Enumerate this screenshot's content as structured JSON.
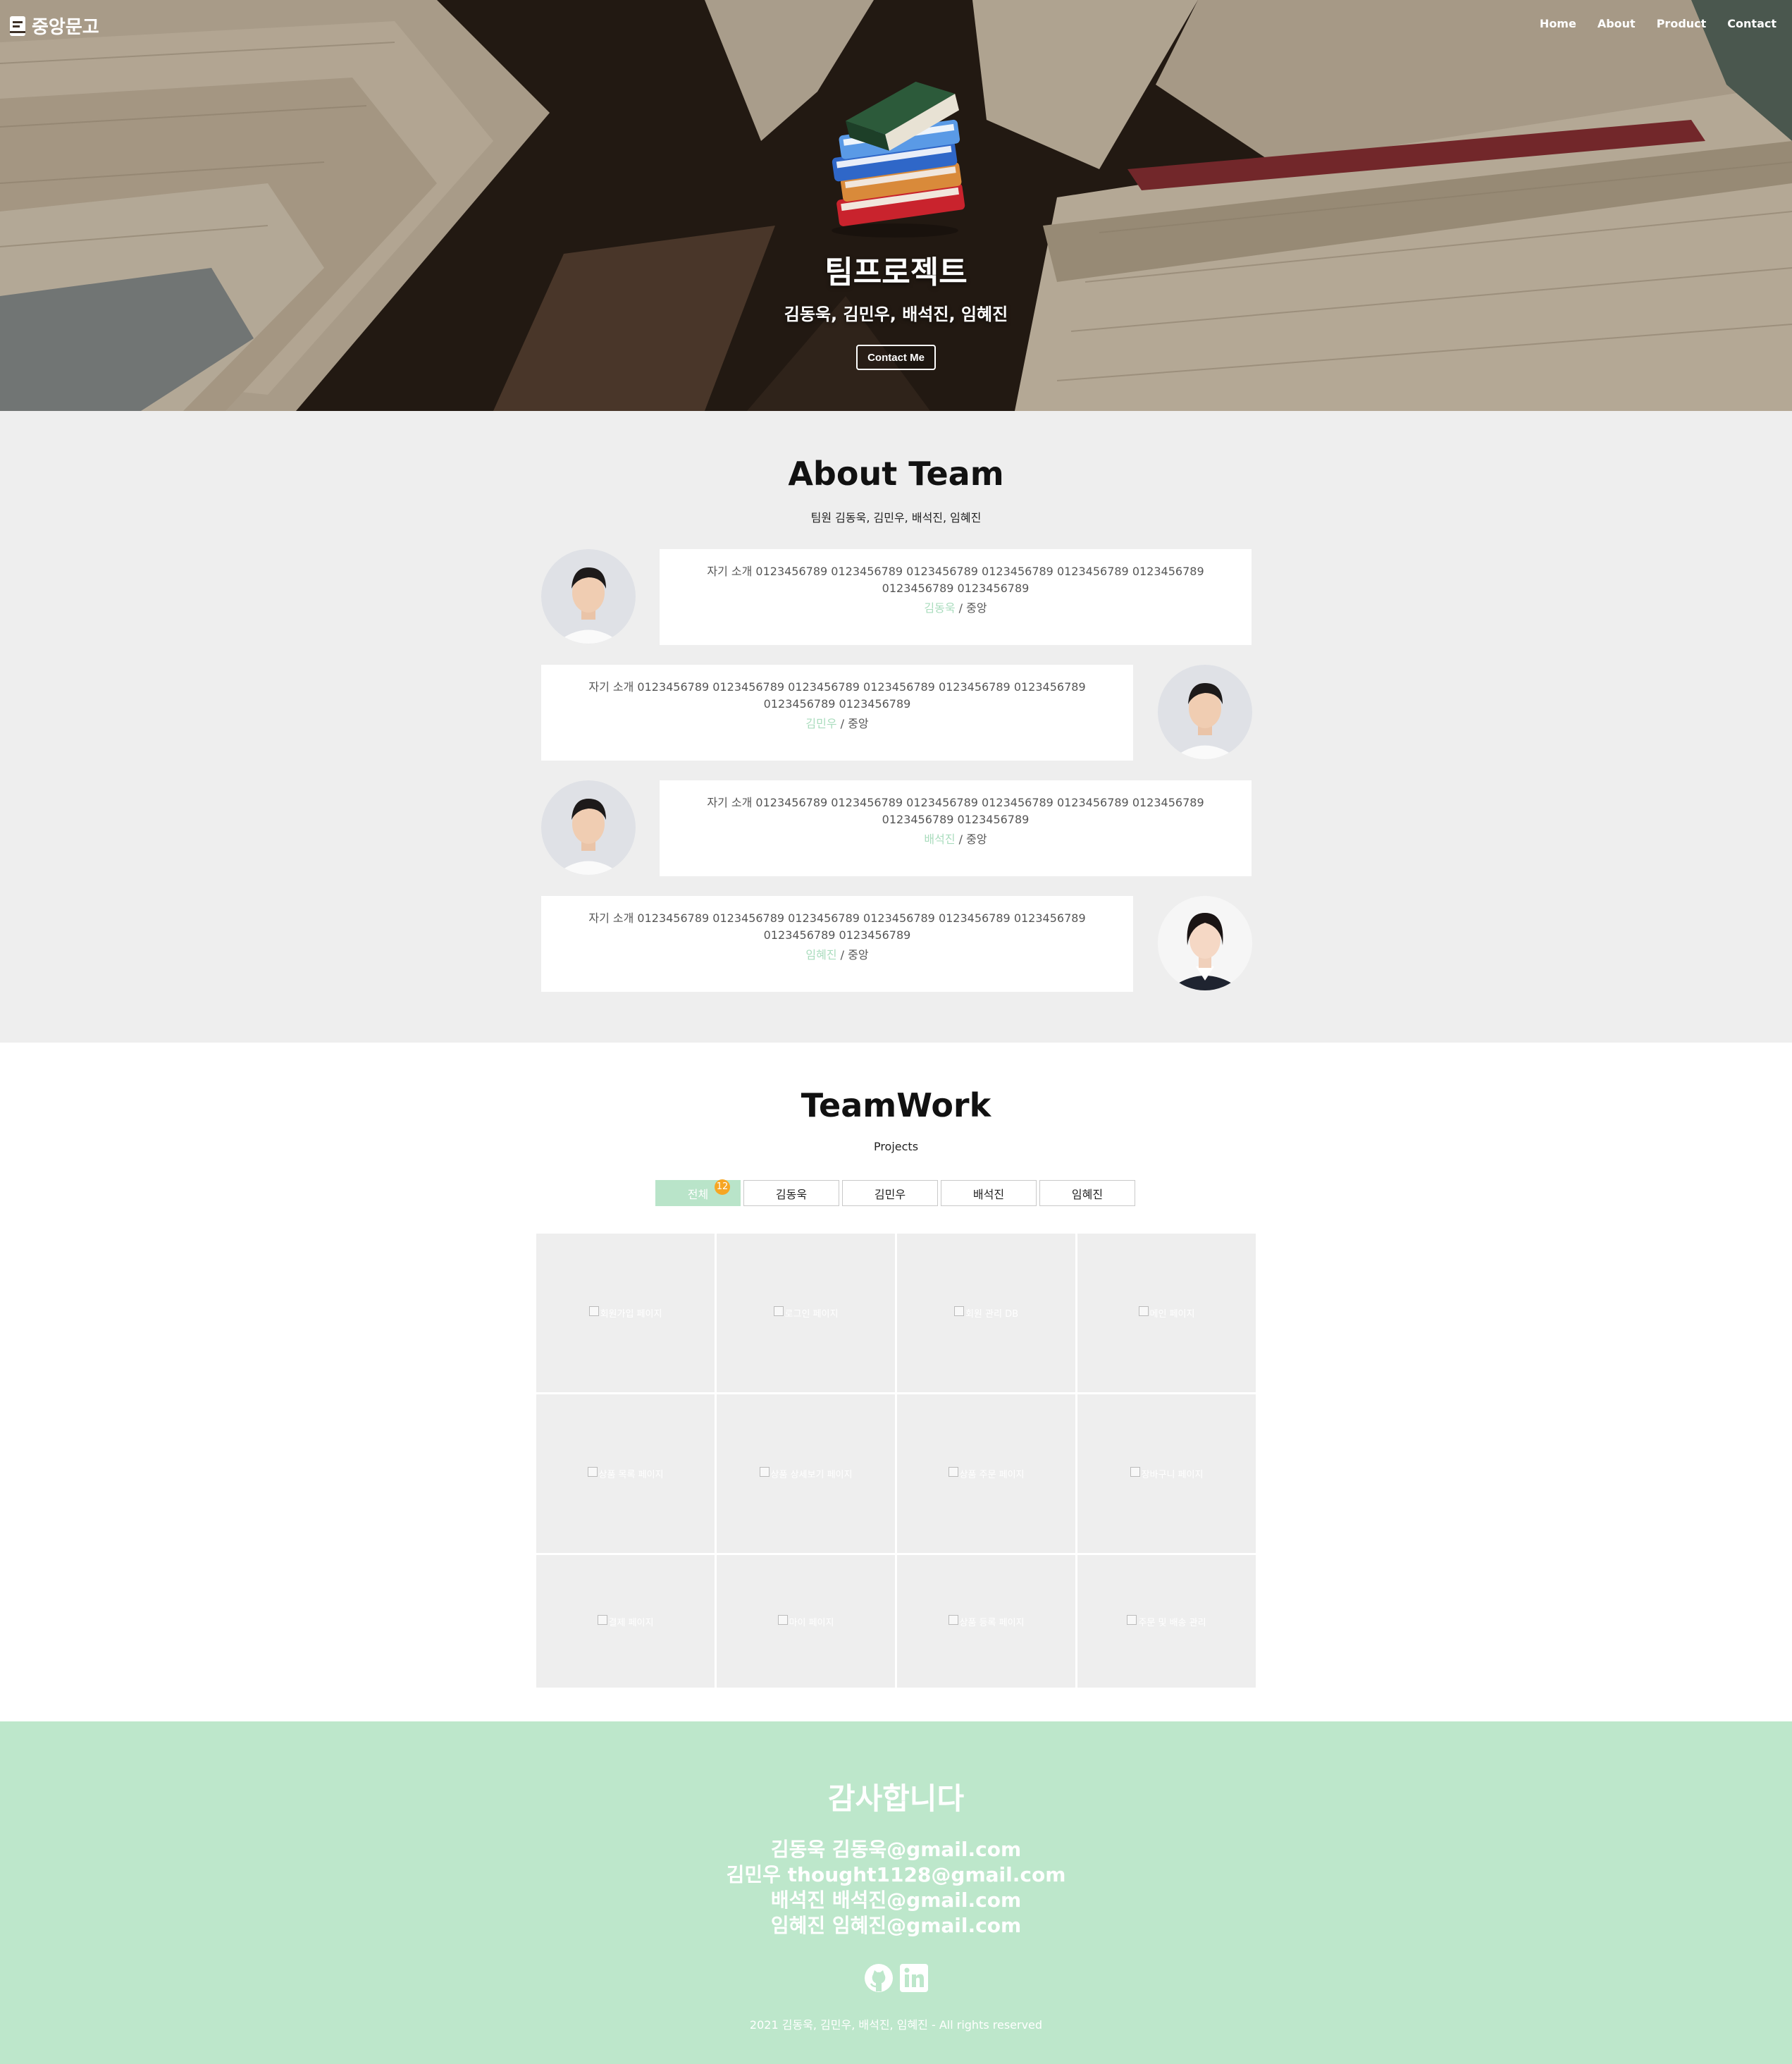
{
  "navbar": {
    "brand": "중앙문고",
    "links": [
      "Home",
      "About",
      "Product",
      "Contact"
    ]
  },
  "hero": {
    "title": "팀프로젝트",
    "subtitle": "김동욱, 김민우, 배석진, 임혜진",
    "button": "Contact Me"
  },
  "about": {
    "title": "About Team",
    "subtitle": "팀원 김동욱, 김민우, 배석진, 임혜진",
    "members": [
      {
        "intro": "자기 소개 0123456789 0123456789 0123456789 0123456789 0123456789 0123456789 0123456789 0123456789",
        "name": "김동욱",
        "sep": " / ",
        "org": "중앙",
        "avatar": "male"
      },
      {
        "intro": "자기 소개 0123456789 0123456789 0123456789 0123456789 0123456789 0123456789 0123456789 0123456789",
        "name": "김민우",
        "sep": " / ",
        "org": "중앙",
        "avatar": "male"
      },
      {
        "intro": "자기 소개 0123456789 0123456789 0123456789 0123456789 0123456789 0123456789 0123456789 0123456789",
        "name": "배석진",
        "sep": " / ",
        "org": "중앙",
        "avatar": "male"
      },
      {
        "intro": "자기 소개 0123456789 0123456789 0123456789 0123456789 0123456789 0123456789 0123456789 0123456789",
        "name": "임혜진",
        "sep": " / ",
        "org": "중앙",
        "avatar": "female"
      }
    ]
  },
  "teamwork": {
    "title": "TeamWork",
    "subtitle": "Projects",
    "filters": [
      {
        "label": "전체",
        "badge": "12",
        "active": true
      },
      {
        "label": "김동욱"
      },
      {
        "label": "김민우"
      },
      {
        "label": "배석진"
      },
      {
        "label": "임혜진"
      }
    ],
    "projects": [
      "회원가입 페이지",
      "로그인 페이지",
      "회원 관리 DB",
      "메인 페이지",
      "상품 목록 페이지",
      "상품 상세보기 페이지",
      "상품 주문 페이지",
      "장바구니 페이지",
      "결제 페이지",
      "마이 페이지",
      "상품 등록 페이지",
      "주문 및 배송 관리"
    ]
  },
  "footer": {
    "title": "감사합니다",
    "contacts": [
      "김동욱 김동욱@gmail.com",
      "김민우 thought1128@gmail.com",
      "배석진 배석진@gmail.com",
      "임혜진 임혜진@gmail.com"
    ],
    "social": [
      "github-icon",
      "linkedin-icon"
    ],
    "copyright": "2021 김동욱, 김민우, 배석진, 임혜진 - All rights reserved"
  },
  "colors": {
    "accent": "#bde7cb",
    "name_text": "#a9dcbd",
    "badge": "#f6a623",
    "section_gray": "#eeeeee"
  }
}
